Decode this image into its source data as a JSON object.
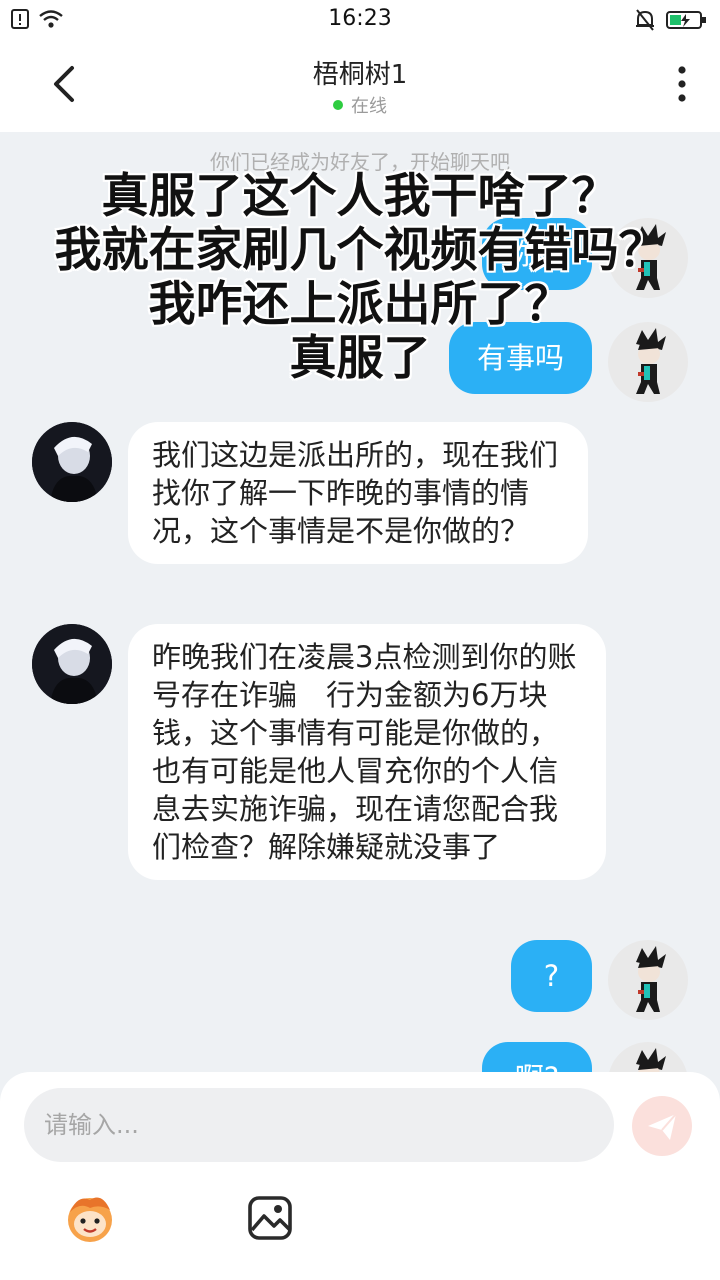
{
  "status_bar": {
    "time": "16:23"
  },
  "header": {
    "title": "梧桐树1",
    "presence": "在线"
  },
  "system_note": "你们已经成为好友了，开始聊天吧",
  "messages": [
    {
      "side": "out",
      "text": "你好"
    },
    {
      "side": "out",
      "text": "有事吗"
    },
    {
      "side": "in",
      "text": "我们这边是派出所的，现在我们找你了解一下昨晚的事情的情况，这个事情是不是你做的？"
    },
    {
      "side": "in",
      "text": "昨晚我们在凌晨3点检测到你的账号存在诈骗　行为金额为6万块钱，这个事情有可能是你做的，也有可能是他人冒充你的个人信息去实施诈骗，现在请您配合我们检查？解除嫌疑就没事了"
    },
    {
      "side": "out",
      "text": "?"
    },
    {
      "side": "out",
      "text": "啊?"
    }
  ],
  "overlay_caption": [
    "真服了这个人我干啥了？",
    "我就在家刷几个视频有错吗？",
    "我咋还上派出所了？",
    "真服了"
  ],
  "input": {
    "placeholder": "请输入..."
  },
  "colors": {
    "accent": "#2bb0f5",
    "online": "#2ecc40",
    "send": "#fbe0dc"
  }
}
